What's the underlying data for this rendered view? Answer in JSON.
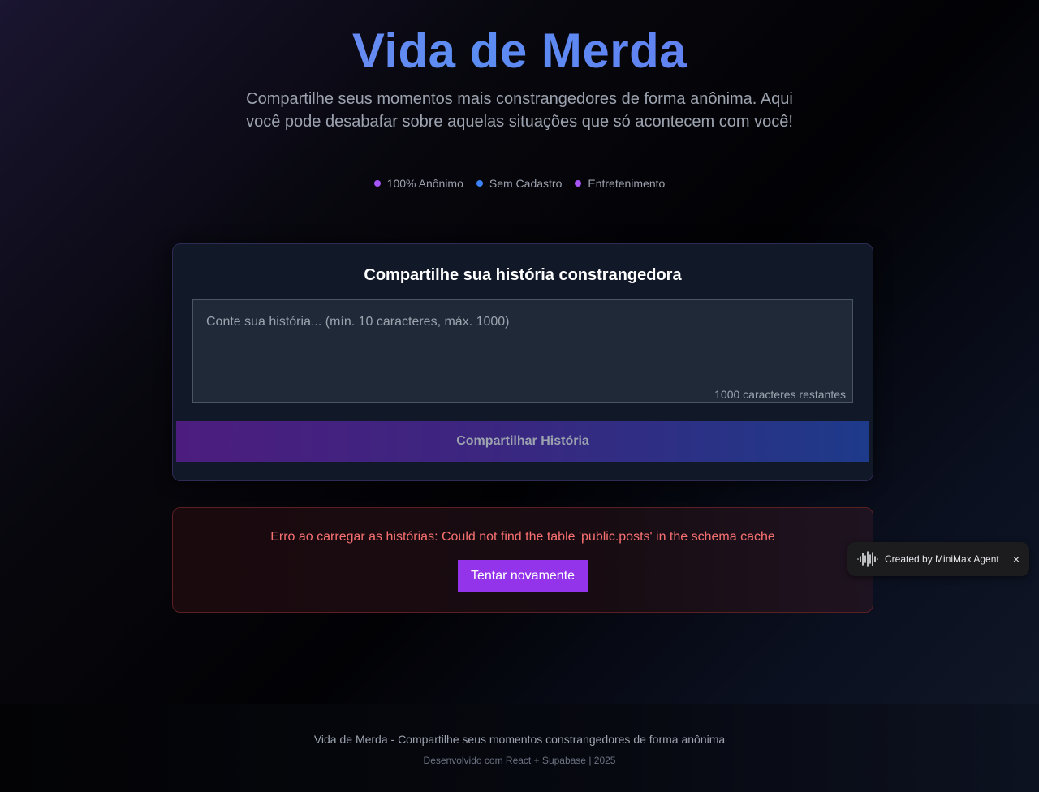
{
  "header": {
    "title": "Vida de Merda",
    "subtitle": "Compartilhe seus momentos mais constrangedores de forma anônima. Aqui você pode desabafar sobre aquelas situações que só acontecem com você!",
    "features": [
      {
        "label": "100% Anônimo",
        "color": "#a855f7"
      },
      {
        "label": "Sem Cadastro",
        "color": "#3b82f6"
      },
      {
        "label": "Entretenimento",
        "color": "#a855f7"
      }
    ]
  },
  "form": {
    "title": "Compartilhe sua história constrangedora",
    "placeholder": "Conte sua história... (mín. 10 caracteres, máx. 1000)",
    "value": "",
    "counter": "1000 caracteres restantes",
    "submit_label": "Compartilhar História"
  },
  "error": {
    "message": "Erro ao carregar as histórias: Could not find the table 'public.posts' in the schema cache",
    "retry_label": "Tentar novamente"
  },
  "badge": {
    "text": "Created by MiniMax Agent",
    "close": "×",
    "icon": "waveform-icon"
  },
  "footer": {
    "main": "Vida de Merda - Compartilhe seus momentos constrangedores de forma anônima",
    "sub": "Desenvolvido com React + Supabase | 2025"
  },
  "colors": {
    "accent_purple": "#9333ea",
    "accent_blue": "#3b82f6",
    "error_red": "#f87171"
  }
}
